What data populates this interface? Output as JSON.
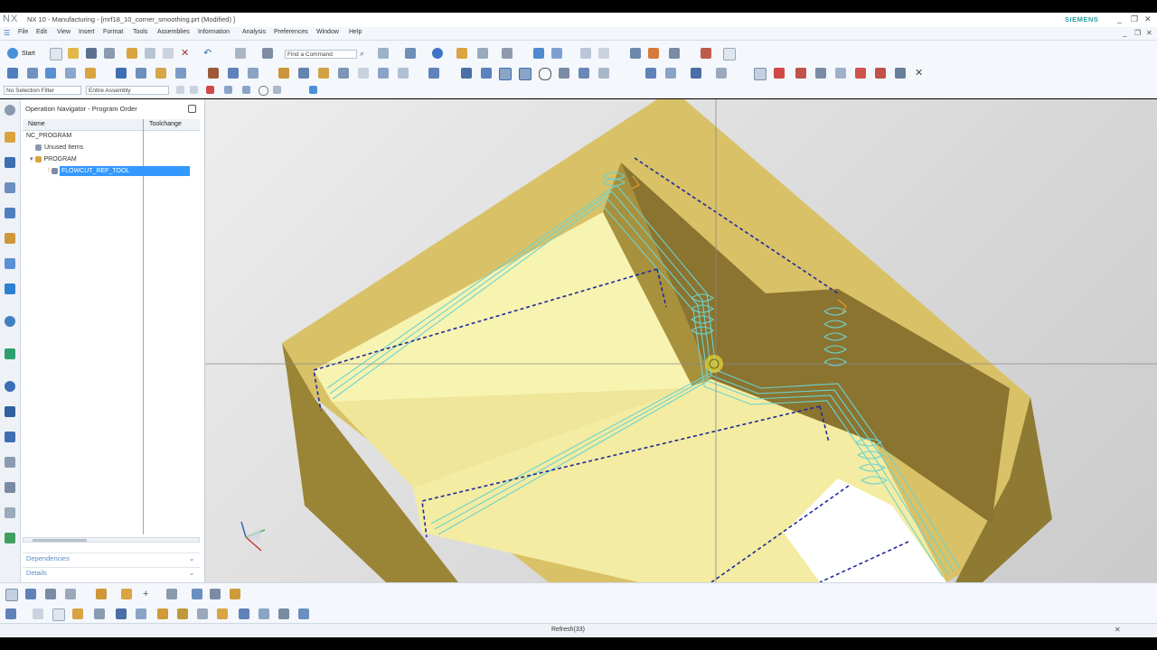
{
  "window": {
    "app_logo": "NX",
    "title": "NX 10 - Manufacturing - [mrf18_10_corner_smoothing.prt (Modified) ]",
    "brand": "SIEMENS",
    "controls": [
      "_",
      "❐",
      "✕"
    ]
  },
  "menu": {
    "items": [
      "File",
      "Edit",
      "View",
      "Insert",
      "Format",
      "Tools",
      "Assemblies",
      "Information",
      "Analysis",
      "Preferences",
      "Window",
      "Help"
    ],
    "window_controls": [
      "_",
      "❐",
      "✕"
    ]
  },
  "toolbar": {
    "start_label": "Start",
    "find_command_placeholder": "Find a Command"
  },
  "selection": {
    "filter_value": "No Selection Filter",
    "scope_value": "Entire Assembly"
  },
  "navigator": {
    "title": "Operation Navigator - Program Order",
    "columns": [
      "Name",
      "Toolchange"
    ],
    "tree": [
      {
        "label": "NC_PROGRAM"
      },
      {
        "label": "Unused Items"
      },
      {
        "label": "PROGRAM"
      },
      {
        "label": "FLOWCUT_REF_TOOL",
        "selected": true
      }
    ],
    "sections": [
      "Dependencies",
      "Details"
    ]
  },
  "status": {
    "text": "Refresh(33)"
  },
  "colors": {
    "part_face": "#c0a84e",
    "part_top": "#e0c96a",
    "floor": "#f7f3b1",
    "toolpath": "#6dd3cf",
    "rapid": "#1f2a9c",
    "selection": "#3399ff"
  }
}
